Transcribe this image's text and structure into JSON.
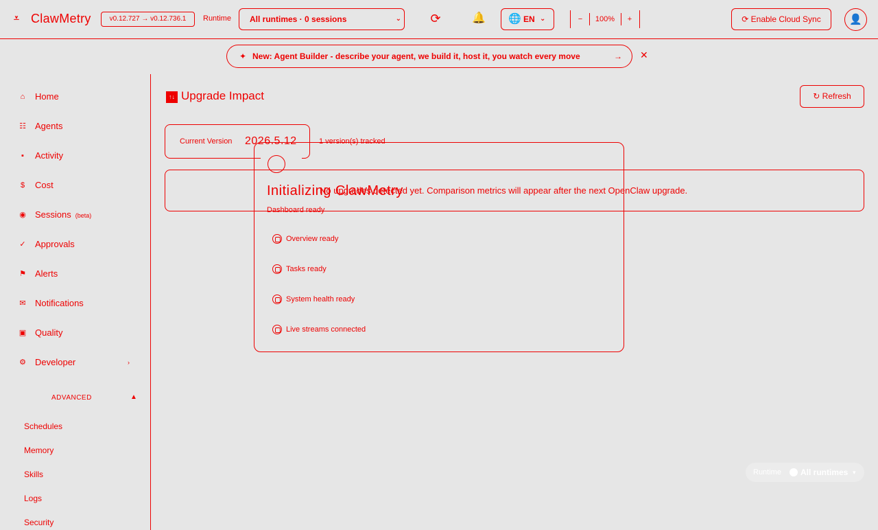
{
  "header": {
    "logo_icon": "⩡",
    "app_name": "ClawMetry",
    "version_badge": "v0.12.727 → v0.12.736.1",
    "runtime_label": "Runtime",
    "runtime_select": "All runtimes · 0 sessions",
    "refresh_icon": "⟳",
    "bell_icon": "🔔",
    "language": "EN",
    "zoom_minus": "−",
    "zoom_level": "100%",
    "zoom_plus": "+",
    "cloud_sync_label": "⟳ Enable Cloud Sync",
    "user_icon": "👤"
  },
  "announcement": {
    "icon": "✦",
    "text": "New: Agent Builder - describe your agent, we build it, host it, you watch every move",
    "arrow": "→",
    "close": "✕"
  },
  "sidebar": {
    "items": [
      {
        "icon": "⌂",
        "label": "Home"
      },
      {
        "icon": "☷",
        "label": "Agents"
      },
      {
        "icon": "▪",
        "label": "Activity"
      },
      {
        "icon": "$",
        "label": "Cost"
      },
      {
        "icon": "◉",
        "label": "Sessions",
        "badge": "(beta)"
      },
      {
        "icon": "✓",
        "label": "Approvals"
      },
      {
        "icon": "⚑",
        "label": "Alerts"
      },
      {
        "icon": "✉",
        "label": "Notifications"
      },
      {
        "icon": "▣",
        "label": "Quality"
      },
      {
        "icon": "⚙",
        "label": "Developer",
        "chevron": "›"
      }
    ],
    "advanced_label": "ADVANCED",
    "advanced_caret": "▲",
    "advanced_items": [
      "Schedules",
      "Memory",
      "Skills",
      "Logs",
      "Security"
    ]
  },
  "main": {
    "title_icon": "↑↓",
    "title": "Upgrade Impact",
    "refresh_label": "↻ Refresh",
    "current_version_label": "Current Version",
    "current_version_value": "2026.5.12",
    "tracked_text": "1 version(s) tracked",
    "no_data_message": "No upgrades detected yet. Comparison metrics will appear after the next OpenClaw upgrade."
  },
  "loader": {
    "title": "Initializing ClawMetry",
    "subtitle": "Dashboard ready",
    "checks": [
      "Overview ready",
      "Tasks ready",
      "System health ready",
      "Live streams connected"
    ]
  },
  "floating_runtime": {
    "label": "Runtime",
    "value": "All runtimes",
    "caret": "▾"
  },
  "colors": {
    "foreground": "#ee0000",
    "background": "#e6e6e6"
  }
}
